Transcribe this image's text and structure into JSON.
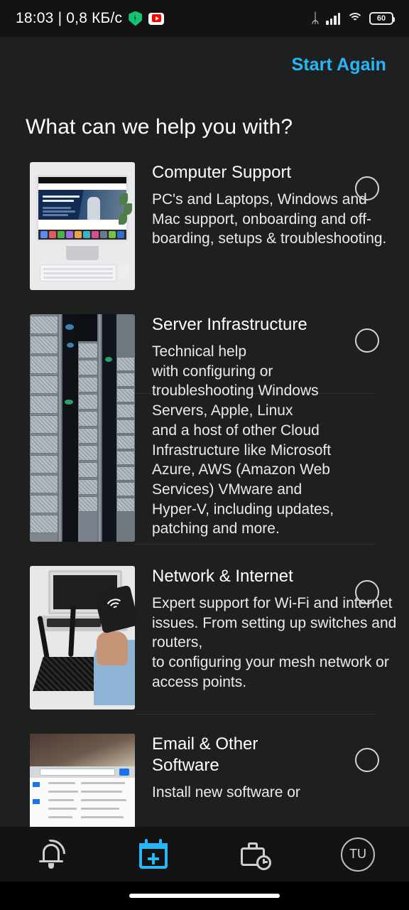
{
  "statusbar": {
    "clock": "18:03 | 0,8 КБ/с",
    "vpn_icon": "shield-icon",
    "youtube_icon": "youtube-icon",
    "bluetooth_glyph": "ᛦ",
    "signal_icon": "signal-bars-icon",
    "wifi_icon": "wifi-icon",
    "battery_level": "60"
  },
  "header": {
    "start_again_label": "Start Again"
  },
  "page_title": "What can we help you with?",
  "options": [
    {
      "title": "Computer Support",
      "description": "PC's and Laptops, Windows and Mac support, onboarding and off-boarding, setups & troubleshooting.",
      "thumbnail": "imac-desktop-photo",
      "selected": false
    },
    {
      "title": "Server Infrastructure",
      "description": "Technical help\nwith configuring or\ntroubleshooting Windows\nServers, Apple, Linux\nand a host of other Cloud\nInfrastructure like Microsoft\nAzure, AWS (Amazon Web\nServices) VMware and\nHyper-V, including updates,\npatching and more.",
      "thumbnail": "server-rack-photo",
      "selected": false
    },
    {
      "title": "Network & Internet",
      "description": "Expert support for Wi-Fi and internet issues. From setting up switches and routers,\nto configuring your mesh network or access points.",
      "thumbnail": "wifi-router-photo",
      "selected": false
    },
    {
      "title": "Email & Other Software",
      "description": "Install new software or",
      "thumbnail": "email-inbox-photo",
      "selected": false
    }
  ],
  "bottom_nav": {
    "items": [
      {
        "name": "notifications",
        "icon": "bell-icon",
        "active": false
      },
      {
        "name": "new-booking",
        "icon": "calendar-plus-icon",
        "active": true
      },
      {
        "name": "job-history",
        "icon": "briefcase-clock-icon",
        "active": false
      },
      {
        "name": "profile",
        "icon": "avatar-icon",
        "active": false,
        "initials": "TU"
      }
    ]
  },
  "colors": {
    "accent": "#29b6f6",
    "background": "#1e1f1f",
    "bar_background": "#131313",
    "text": "#ffffff",
    "badge_red": "#e02020"
  }
}
